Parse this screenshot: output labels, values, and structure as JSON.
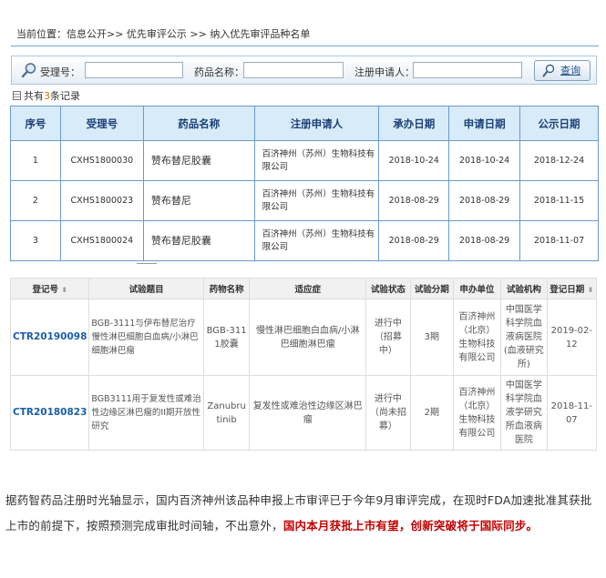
{
  "breadcrumb": "当前位置：信息公开>> 优先审评公示 >> 纳入优先审评品种名单",
  "search": {
    "accept_label": "受理号：",
    "drug_label": "药品名称：",
    "applicant_label": "注册申请人：",
    "query_button": "查询"
  },
  "count": {
    "prefix": "共有",
    "value": "3",
    "suffix": "条记录"
  },
  "table1": {
    "headers": [
      "序号",
      "受理号",
      "药品名称",
      "注册申请人",
      "承办日期",
      "申请日期",
      "公示日期"
    ],
    "rows": [
      {
        "no": "1",
        "code": "CXHS1800030",
        "drug": "赞布替尼胶囊",
        "applicant": "百济神州（苏州）生物科技有限公司",
        "undertake": "2018-10-24",
        "apply": "2018-10-24",
        "publish": "2018-12-24"
      },
      {
        "no": "2",
        "code": "CXHS1800023",
        "drug": "赞布替尼",
        "applicant": "百济神州（苏州）生物科技有限公司",
        "undertake": "2018-08-29",
        "apply": "2018-08-29",
        "publish": "2018-11-15"
      },
      {
        "no": "3",
        "code": "CXHS1800024",
        "drug": "赞布替尼胶囊",
        "applicant": "百济神州（苏州）生物科技有限公司",
        "undertake": "2018-08-29",
        "apply": "2018-08-29",
        "publish": "2018-11-07"
      }
    ]
  },
  "table2": {
    "headers": [
      "登记号",
      "试验题目",
      "药物名称",
      "适应症",
      "试验状态",
      "试验分期",
      "申办单位",
      "试验机构",
      "登记日期"
    ],
    "rows": [
      {
        "reg": "CTR20190098",
        "title": "BGB-3111与伊布替尼治疗慢性淋巴细胞白血病/小淋巴细胞淋巴瘤",
        "drug": "BGB-3111胶囊",
        "indication": "慢性淋巴细胞白血病/小淋巴细胞淋巴瘤",
        "status": "进行中（招募中）",
        "phase": "3期",
        "sponsor": "百济神州（北京）生物科技有限公司",
        "site": "中国医学科学院血液病医院(血液研究所)",
        "date": "2019-02-12"
      },
      {
        "reg": "CTR20180823",
        "title": "BGB3111用于复发性或难治性边缘区淋巴瘤的II期开放性研究",
        "drug": "Zanubrutinib",
        "indication": "复发性或难治性边缘区淋巴瘤",
        "status": "进行中（尚未招募）",
        "phase": "2期",
        "sponsor": "百济神州（北京）生物科技有限公司",
        "site": "中国医学科学院血液学研究所血液病医院",
        "date": "2018-11-07"
      }
    ]
  },
  "paragraph": {
    "text": "据药智药品注册时光轴显示，国内百济神州该品种申报上市审评已于今年9月审评完成，在现时FDA加速批准其获批上市的前提下，按照预测完成审批时间轴，不出意外，",
    "highlight": "国内本月获批上市有望，创新突破将于国际同步。"
  },
  "colors": {
    "accent": "#1a3f77",
    "header_bg": "#d8ebf9",
    "border": "#6a9ad0",
    "highlight": "#c40000",
    "count": "#e07000"
  }
}
